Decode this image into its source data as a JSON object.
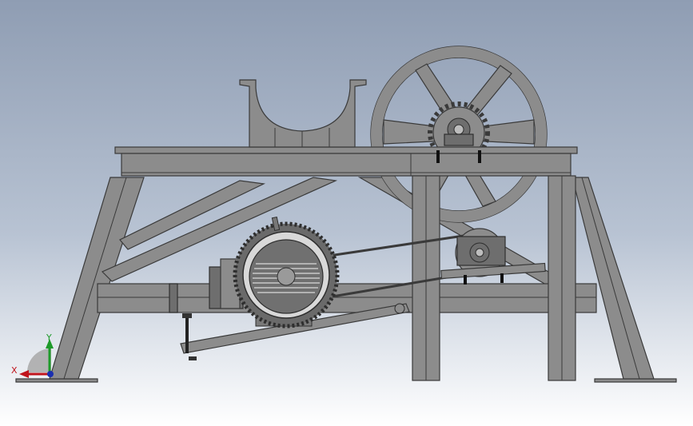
{
  "triad": {
    "x_label": "X",
    "y_label": "Y",
    "x_color": "#c0141c",
    "y_color": "#1e9a2a",
    "z_color": "#1a2fb0"
  },
  "colors": {
    "background_top": "#8f9db3",
    "background_bottom": "#ffffff",
    "steel": "#8c8c8c",
    "outline": "#3a3a3a"
  }
}
